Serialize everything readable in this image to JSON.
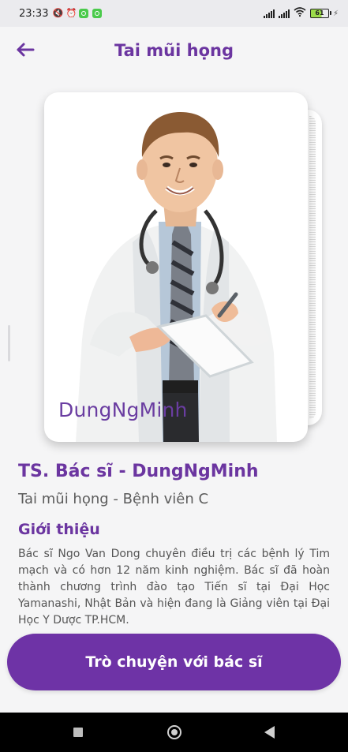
{
  "status_bar": {
    "time": "23:33",
    "battery_level": "61",
    "icons": [
      "mute-icon",
      "alarm-icon",
      "app-icon",
      "app-icon",
      "signal-icon",
      "signal-icon",
      "wifi-icon",
      "battery-icon",
      "charging-icon"
    ]
  },
  "header": {
    "title": "Tai mũi họng",
    "back_icon": "back-arrow-icon"
  },
  "doctor": {
    "watermark": "DungNgMinh",
    "name": "TS. Bác sĩ - DungNgMinh",
    "specialty": "Tai mũi họng - Bệnh viên C"
  },
  "intro": {
    "heading": "Giới thiệu",
    "text": "Bác sĩ Ngo Van Dong chuyên điều trị các bệnh lý Tim mạch và có hơn 12 năm kinh nghiệm. Bác sĩ đã hoàn thành chương trình đào tạo Tiến sĩ tại Đại Học Yamanashi, Nhật Bản và hiện đang là Giảng viên tại Đại Học Y Dược TP.HCM."
  },
  "actions": {
    "chat_label": "Trò chuyện với bác sĩ"
  },
  "colors": {
    "accent": "#6e33a6",
    "title": "#6b35a0",
    "background": "#f5f5f6"
  },
  "navigation": [
    "recents-icon",
    "home-icon",
    "back-icon"
  ]
}
